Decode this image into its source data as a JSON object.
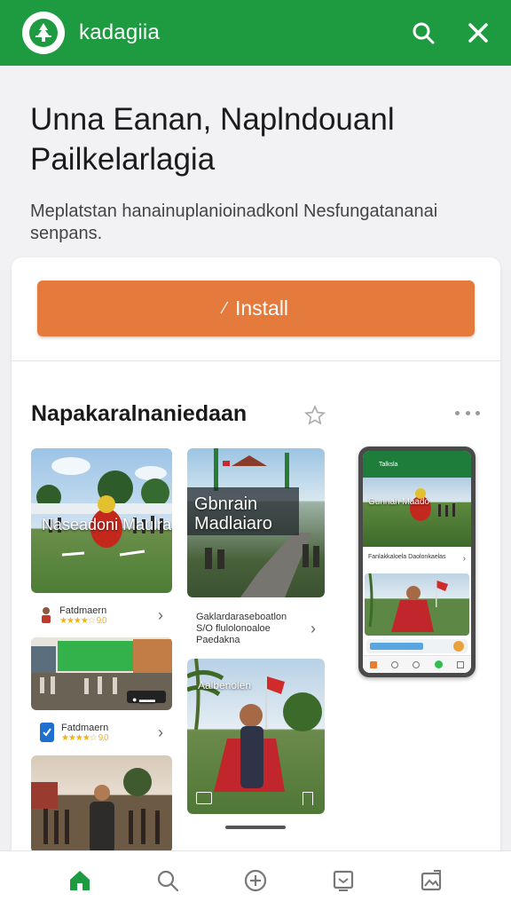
{
  "app": {
    "name": "kadagiia"
  },
  "hero": {
    "title": "Unna Eanan, Naplndouanl Pailkelarlagia",
    "subtitle": "Meplatstan hanainuplanioinadkonl Nesfungatananai senpans."
  },
  "install": {
    "label": "Install"
  },
  "section": {
    "title": "Napakaralnaniedaan"
  },
  "tiles": {
    "t1": {
      "overlay": "Naseadoni Maulra"
    },
    "t2": {
      "name": "Fatdmaern",
      "stars": "★★★★☆ 9.0"
    },
    "t3": {
      "overlay": "Gbnrain Madlaiaro"
    },
    "t4": {
      "info": "Gaklardaraseboatlon S/O flulolonoaloe Paedakna"
    },
    "t5": {
      "badge": "● ▬▬"
    },
    "t6": {
      "name": "Fatdmaern",
      "stars": "★★★★☆ 9.0"
    },
    "t7": {
      "overlay": "Aalbenolen"
    }
  },
  "phone": {
    "header": "Talksla",
    "card1_overlay": "Gunnah Maado",
    "row_text": "Fanlakkaloela Daolonkaelas"
  },
  "colors": {
    "brand_green": "#1e9a41",
    "install_orange": "#e47a3c"
  },
  "icons": {
    "logo": "leaf-emblem-icon",
    "search": "search-icon",
    "close": "close-icon",
    "star": "star-outline-icon",
    "more": "more-dots-icon",
    "nav": [
      "home-icon",
      "search-icon",
      "add-circle-icon",
      "inbox-icon",
      "gallery-icon"
    ]
  }
}
